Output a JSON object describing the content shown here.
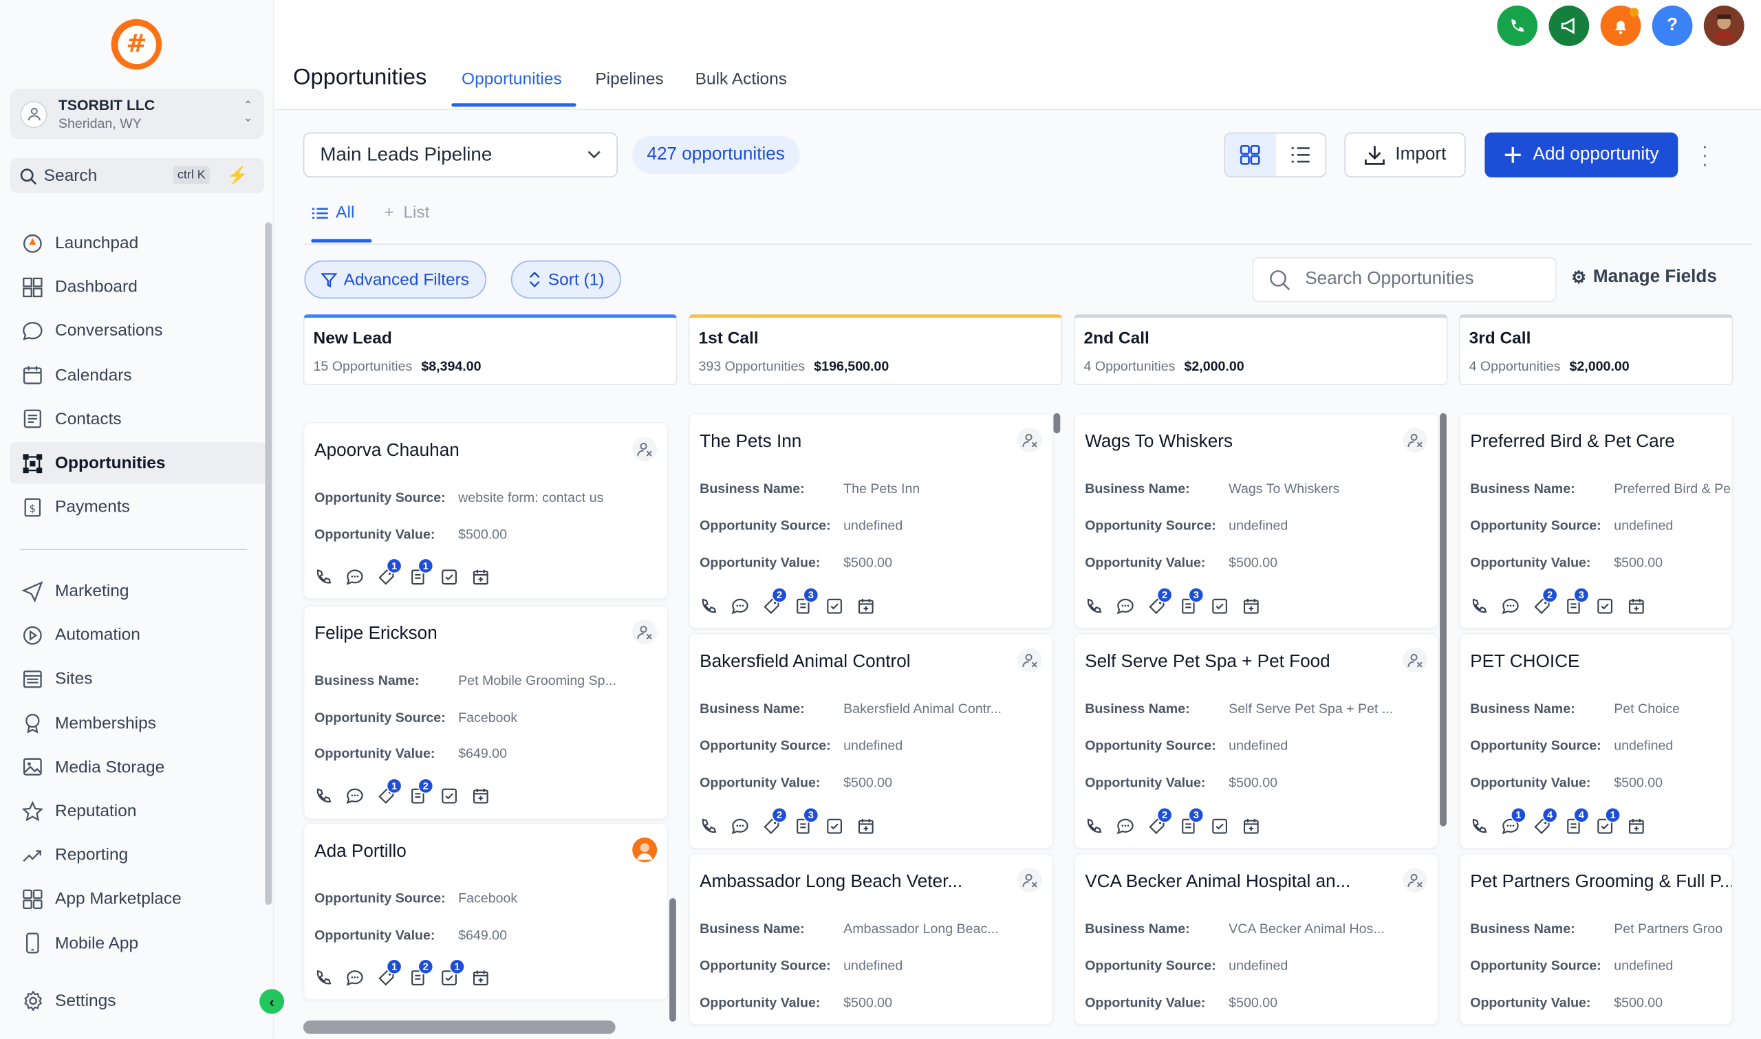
{
  "account": {
    "name": "TSORBIT LLC",
    "location": "Sheridan, WY"
  },
  "search": {
    "label": "Search",
    "shortcut": "ctrl K"
  },
  "nav_primary": [
    {
      "label": "Launchpad",
      "icon": "launchpad-icon"
    },
    {
      "label": "Dashboard",
      "icon": "dashboard-icon"
    },
    {
      "label": "Conversations",
      "icon": "chat-icon"
    },
    {
      "label": "Calendars",
      "icon": "calendar-icon"
    },
    {
      "label": "Contacts",
      "icon": "contacts-icon"
    },
    {
      "label": "Opportunities",
      "icon": "opportunities-icon",
      "active": true
    },
    {
      "label": "Payments",
      "icon": "payments-icon"
    }
  ],
  "nav_secondary": [
    {
      "label": "Marketing",
      "icon": "send-icon"
    },
    {
      "label": "Automation",
      "icon": "automation-icon"
    },
    {
      "label": "Sites",
      "icon": "sites-icon"
    },
    {
      "label": "Memberships",
      "icon": "membership-icon"
    },
    {
      "label": "Media Storage",
      "icon": "media-icon"
    },
    {
      "label": "Reputation",
      "icon": "star-icon"
    },
    {
      "label": "Reporting",
      "icon": "trend-icon"
    },
    {
      "label": "App Marketplace",
      "icon": "apps-icon"
    },
    {
      "label": "Mobile App",
      "icon": "mobile-icon"
    }
  ],
  "settings_label": "Settings",
  "header": {
    "title": "Opportunities",
    "tabs": [
      {
        "label": "Opportunities",
        "active": true
      },
      {
        "label": "Pipelines"
      },
      {
        "label": "Bulk Actions"
      }
    ]
  },
  "top_icons": [
    {
      "name": "phone-icon",
      "color": "#16a34a"
    },
    {
      "name": "megaphone-icon",
      "color": "#15803d"
    },
    {
      "name": "bell-icon",
      "color": "#f97316"
    },
    {
      "name": "help-icon",
      "color": "#3b82f6"
    }
  ],
  "toolbar": {
    "pipeline": "Main Leads Pipeline",
    "count": "427 opportunities",
    "import_label": "Import",
    "add_label": "Add opportunity"
  },
  "subtabs": {
    "all": "All",
    "list": "List"
  },
  "filters": {
    "advanced": "Advanced Filters",
    "sort": "Sort (1)",
    "search_placeholder": "Search Opportunities",
    "manage": "Manage Fields"
  },
  "labels": {
    "business": "Business Name:",
    "source": "Opportunity Source:",
    "value": "Opportunity Value:"
  },
  "columns": [
    {
      "title": "New Lead",
      "count": "15 Opportunities",
      "total": "$8,394.00",
      "accent": "#3b82f6",
      "cards": [
        {
          "title": "Apoorva Chauhan",
          "source": "website form: contact us",
          "value": "$500.00",
          "badges": [
            0,
            0,
            1,
            1,
            0,
            0
          ]
        },
        {
          "title": "Felipe Erickson",
          "business": "Pet Mobile Grooming Sp...",
          "source": "Facebook",
          "value": "$649.00",
          "badges": [
            0,
            0,
            1,
            2,
            0,
            0
          ]
        },
        {
          "title": "Ada Portillo",
          "source": "Facebook",
          "value": "$649.00",
          "badges": [
            0,
            0,
            1,
            2,
            1,
            0
          ],
          "photo": true
        }
      ]
    },
    {
      "title": "1st Call",
      "count": "393 Opportunities",
      "total": "$196,500.00",
      "accent": "#f5c04a",
      "cards": [
        {
          "title": "The Pets Inn",
          "business": "The Pets Inn",
          "source": "undefined",
          "value": "$500.00",
          "badges": [
            0,
            0,
            2,
            3,
            0,
            0
          ]
        },
        {
          "title": "Bakersfield Animal Control",
          "business": "Bakersfield Animal Contr...",
          "source": "undefined",
          "value": "$500.00",
          "badges": [
            0,
            0,
            2,
            3,
            0,
            0
          ]
        },
        {
          "title": "Ambassador Long Beach Veter...",
          "business": "Ambassador Long Beac...",
          "source": "undefined",
          "value": "$500.00",
          "badges": [
            0,
            0,
            0,
            0,
            0,
            0
          ]
        }
      ]
    },
    {
      "title": "2nd Call",
      "count": "4 Opportunities",
      "total": "$2,000.00",
      "accent": "#d1d5db",
      "cards": [
        {
          "title": "Wags To Whiskers",
          "business": "Wags To Whiskers",
          "source": "undefined",
          "value": "$500.00",
          "badges": [
            0,
            0,
            2,
            3,
            0,
            0
          ]
        },
        {
          "title": "Self Serve Pet Spa + Pet Food",
          "business": "Self Serve Pet Spa + Pet ...",
          "source": "undefined",
          "value": "$500.00",
          "badges": [
            0,
            0,
            2,
            3,
            0,
            0
          ]
        },
        {
          "title": "VCA Becker Animal Hospital an...",
          "business": "VCA Becker Animal Hos...",
          "source": "undefined",
          "value": "$500.00",
          "badges": [
            0,
            0,
            0,
            0,
            0,
            0
          ]
        }
      ]
    },
    {
      "title": "3rd Call",
      "count": "4 Opportunities",
      "total": "$2,000.00",
      "accent": "#d1d5db",
      "cards": [
        {
          "title": "Preferred Bird & Pet Care",
          "business": "Preferred Bird & Pe",
          "source": "undefined",
          "value": "$500.00",
          "badges": [
            0,
            0,
            2,
            3,
            0,
            0
          ]
        },
        {
          "title": "PET CHOICE",
          "business": "Pet Choice",
          "source": "undefined",
          "value": "$500.00",
          "badges": [
            0,
            1,
            4,
            4,
            1,
            0
          ]
        },
        {
          "title": "Pet Partners Grooming & Full P...",
          "business": "Pet Partners Groo",
          "source": "undefined",
          "value": "$500.00",
          "badges": [
            0,
            0,
            0,
            0,
            0,
            0
          ]
        }
      ]
    }
  ]
}
